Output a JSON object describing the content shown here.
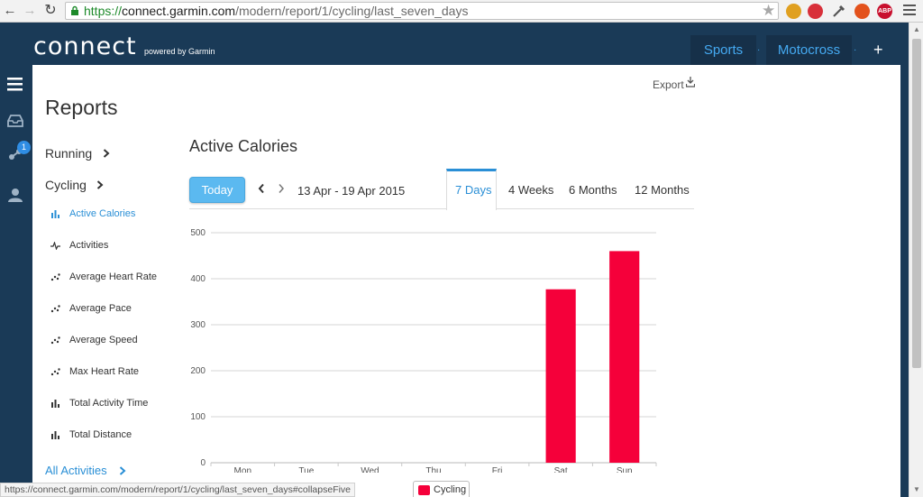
{
  "browser": {
    "url_scheme": "https://",
    "url_host": "connect.garmin.com",
    "url_path": "/modern/report/1/cycling/last_seven_days",
    "extension_badge": "ABP",
    "status_url": "https://connect.garmin.com/modern/report/1/cycling/last_seven_days#collapseFive"
  },
  "header": {
    "logo_text": "connect",
    "logo_sub": "powered by Garmin",
    "tabs": [
      {
        "label": "Sports"
      },
      {
        "label": "Motocross"
      }
    ],
    "plus_label": "+"
  },
  "rail": {
    "notification_count": "1"
  },
  "page": {
    "title": "Reports",
    "export_label": "Export"
  },
  "sidebar": {
    "sections": [
      {
        "label": "Running"
      },
      {
        "label": "Cycling"
      }
    ],
    "items": [
      {
        "label": "Active Calories",
        "icon": "bar-chart-icon"
      },
      {
        "label": "Activities",
        "icon": "pulse-icon"
      },
      {
        "label": "Average Heart Rate",
        "icon": "scatter-icon"
      },
      {
        "label": "Average Pace",
        "icon": "scatter-icon"
      },
      {
        "label": "Average Speed",
        "icon": "scatter-icon"
      },
      {
        "label": "Max Heart Rate",
        "icon": "scatter-icon"
      },
      {
        "label": "Total Activity Time",
        "icon": "bar-chart-icon"
      },
      {
        "label": "Total Distance",
        "icon": "bar-chart-icon"
      }
    ],
    "all_activities": "All Activities"
  },
  "report": {
    "title": "Active Calories",
    "today_label": "Today",
    "date_range": "13 Apr - 19 Apr 2015",
    "period_tabs": [
      {
        "label": "7 Days",
        "active": true
      },
      {
        "label": "4 Weeks",
        "active": false
      },
      {
        "label": "6 Months",
        "active": false
      },
      {
        "label": "12 Months",
        "active": false
      }
    ]
  },
  "colors": {
    "accent": "#2a8fd6",
    "navy": "#1a3a57",
    "bar": "#f5003a"
  },
  "chart_data": {
    "type": "bar",
    "categories": [
      "Mon",
      "Tue",
      "Wed",
      "Thu",
      "Fri",
      "Sat",
      "Sun"
    ],
    "series": [
      {
        "name": "Cycling",
        "values": [
          0,
          0,
          0,
          0,
          0,
          377,
          460
        ]
      }
    ],
    "ylim": [
      0,
      500
    ],
    "yticks": [
      0,
      100,
      200,
      300,
      400,
      500
    ],
    "grid": true,
    "legend": "bottom-center"
  }
}
